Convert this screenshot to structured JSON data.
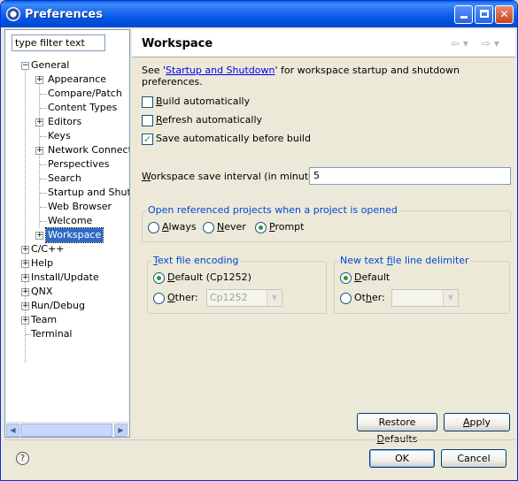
{
  "window": {
    "title": "Preferences",
    "app_icon": "eclipse-icon",
    "controls": [
      "minimize-icon",
      "maximize-icon",
      "close-icon"
    ]
  },
  "filter": {
    "placeholder": "type filter text",
    "value": "type filter text"
  },
  "tree": {
    "general": "General",
    "general_children": [
      "Appearance",
      "Compare/Patch",
      "Content Types",
      "Editors",
      "Keys",
      "Network Connectio",
      "Perspectives",
      "Search",
      "Startup and Shutd",
      "Web Browser",
      "Welcome",
      "Workspace"
    ],
    "roots": [
      "C/C++",
      "Help",
      "Install/Update",
      "QNX",
      "Run/Debug",
      "Team",
      "Terminal"
    ],
    "selected": "Workspace"
  },
  "page": {
    "title": "Workspace",
    "link_prefix": "See '",
    "link_text": "Startup and Shutdown",
    "link_suffix": "' for workspace startup and shutdown preferences.",
    "checkboxes": [
      {
        "mnemonic": "B",
        "rest": "uild automatically",
        "checked": false
      },
      {
        "mnemonic": "R",
        "rest": "efresh automatically",
        "checked": false
      },
      {
        "mnemonic": "",
        "rest": "Save automatically before build",
        "checked": true
      }
    ],
    "interval_mnemonic": "W",
    "interval_label": "orkspace save interval (in minutes):",
    "interval_value": "5",
    "open_projects": {
      "title": "Open referenced projects when a project is opened",
      "options": [
        {
          "mnemonic": "A",
          "rest": "lways"
        },
        {
          "mnemonic": "N",
          "rest": "ever"
        },
        {
          "mnemonic": "P",
          "rest": "rompt"
        }
      ],
      "selected": "Prompt"
    },
    "encoding": {
      "title_mnemonic": "T",
      "title_rest": "ext file encoding",
      "default_mnemonic": "D",
      "default_rest": "efault (Cp1252)",
      "other_mnemonic": "O",
      "other_rest": "ther:",
      "other_value": "Cp1252",
      "selected": "Default (Cp1252)"
    },
    "delimiter": {
      "title_pre": "New text ",
      "title_mnemonic": "f",
      "title_rest": "ile line delimiter",
      "default_mnemonic": "D",
      "default_rest": "efault",
      "other_pre": "Ot",
      "other_mnemonic": "h",
      "other_rest": "er:",
      "other_value": "",
      "selected": "Default"
    },
    "restore_defaults": {
      "pre": "Restore ",
      "mnemonic": "D",
      "rest": "efaults"
    },
    "apply": {
      "mnemonic": "A",
      "rest": "pply"
    }
  },
  "footer": {
    "help_icon": "help-icon",
    "ok": "OK",
    "cancel": "Cancel"
  }
}
